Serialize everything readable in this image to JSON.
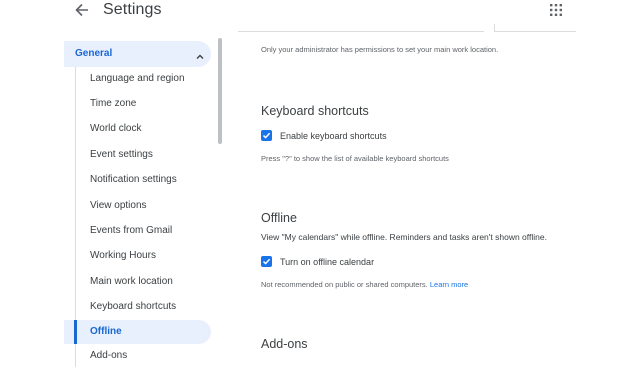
{
  "header": {
    "title": "Settings"
  },
  "sidebar": {
    "general_label": "General",
    "items": [
      {
        "label": "Language and region"
      },
      {
        "label": "Time zone"
      },
      {
        "label": "World clock"
      },
      {
        "label": "Event settings"
      },
      {
        "label": "Notification settings"
      },
      {
        "label": "View options"
      },
      {
        "label": "Events from Gmail"
      },
      {
        "label": "Working Hours"
      },
      {
        "label": "Main work location"
      },
      {
        "label": "Keyboard shortcuts"
      },
      {
        "label": "Offline"
      },
      {
        "label": "Add-ons"
      }
    ],
    "selected": "Offline"
  },
  "main": {
    "admin_note": "Only your administrator has permissions to set your main work location.",
    "keyboard": {
      "title": "Keyboard shortcuts",
      "checkbox_label": "Enable keyboard shortcuts",
      "checked": true,
      "hint": "Press \"?\" to show the list of available keyboard shortcuts"
    },
    "offline": {
      "title": "Offline",
      "description": "View \"My calendars\" while offline. Reminders and tasks aren't shown offline.",
      "checkbox_label": "Turn on offline calendar",
      "checked": true,
      "hint": "Not recommended on public or shared computers.",
      "learn_more": "Learn more"
    },
    "addons": {
      "title": "Add-ons"
    }
  },
  "colors": {
    "accent": "#1a73e8",
    "selected_bg": "#e8f0fe",
    "selected_text": "#1967d2"
  }
}
